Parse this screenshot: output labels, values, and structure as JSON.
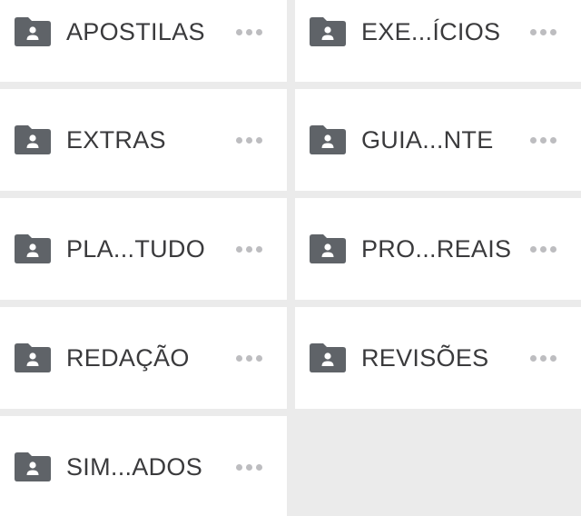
{
  "folders": [
    {
      "name": "APOSTILAS",
      "icon": "folder-shared-icon"
    },
    {
      "name": "EXE...ÍCIOS",
      "icon": "folder-shared-icon"
    },
    {
      "name": "EXTRAS",
      "icon": "folder-shared-icon"
    },
    {
      "name": "GUIA...NTE",
      "icon": "folder-shared-icon"
    },
    {
      "name": "PLA...TUDO",
      "icon": "folder-shared-icon"
    },
    {
      "name": "PRO...REAIS",
      "icon": "folder-shared-icon"
    },
    {
      "name": "REDAÇÃO",
      "icon": "folder-shared-icon"
    },
    {
      "name": "REVISÕES",
      "icon": "folder-shared-icon"
    },
    {
      "name": "SIM...ADOS",
      "icon": "folder-shared-icon"
    }
  ],
  "colors": {
    "folder_icon": "#5f6368",
    "label_text": "#3a3a3c",
    "more_dots": "#bdbdc0",
    "tile_bg": "#ffffff",
    "gutter_bg": "#ebebeb"
  }
}
